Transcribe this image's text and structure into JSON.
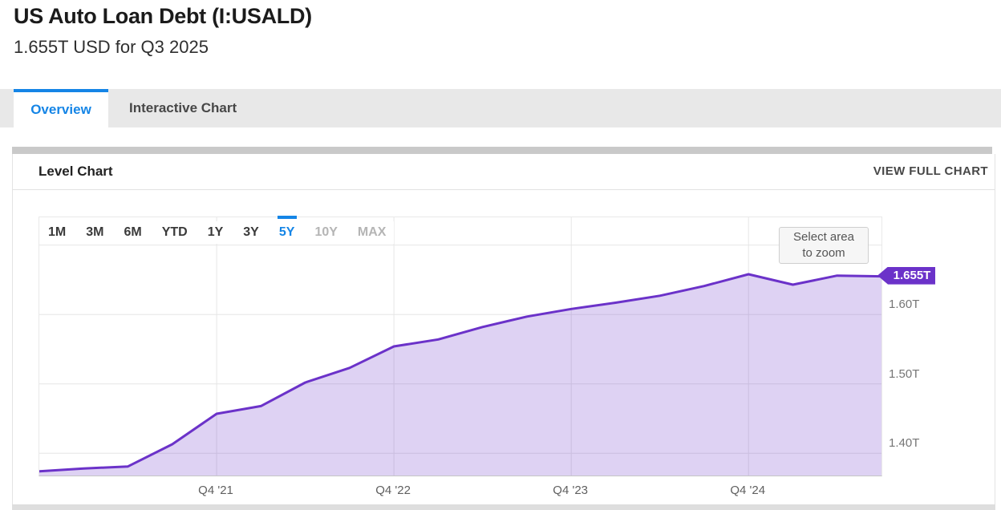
{
  "header": {
    "title": "US Auto Loan Debt (I:USALD)",
    "subtitle": "1.655T USD for Q3 2025"
  },
  "tabs": [
    {
      "label": "Overview",
      "active": true
    },
    {
      "label": "Interactive Chart",
      "active": false
    }
  ],
  "card": {
    "title": "Level Chart",
    "action_label": "VIEW FULL CHART"
  },
  "range_selector": {
    "options": [
      "1M",
      "3M",
      "6M",
      "YTD",
      "1Y",
      "3Y",
      "5Y",
      "10Y",
      "MAX"
    ],
    "selected": "5Y",
    "disabled": [
      "10Y",
      "MAX"
    ]
  },
  "zoom_hint": {
    "line1": "Select area",
    "line2": "to zoom"
  },
  "last_value_badge": "1.655T",
  "colors": {
    "accent_blue": "#1585e6",
    "line_purple": "#6b32c9",
    "badge_purple": "#6b32c9",
    "gridline_gray": "#e6e6e6",
    "area_fill_opacity": 0.22
  },
  "chart_data": {
    "type": "area",
    "title": "Level Chart",
    "unit": "USD trillions",
    "x": [
      "Q4 '20",
      "Q1 '21",
      "Q2 '21",
      "Q3 '21",
      "Q4 '21",
      "Q1 '22",
      "Q2 '22",
      "Q3 '22",
      "Q4 '22",
      "Q1 '23",
      "Q2 '23",
      "Q3 '23",
      "Q4 '23",
      "Q1 '24",
      "Q2 '24",
      "Q3 '24",
      "Q4 '24",
      "Q1 '25",
      "Q2 '25",
      "Q3 '25"
    ],
    "values": [
      1.374,
      1.378,
      1.381,
      1.413,
      1.457,
      1.468,
      1.502,
      1.523,
      1.554,
      1.564,
      1.582,
      1.597,
      1.608,
      1.617,
      1.627,
      1.641,
      1.658,
      1.643,
      1.656,
      1.655
    ],
    "last_value_label": "1.655T",
    "x_tick_indices": [
      4,
      8,
      12,
      16
    ],
    "x_tick_labels": [
      "Q4 '21",
      "Q4 '22",
      "Q4 '23",
      "Q4 '24"
    ],
    "y_ticks": [
      {
        "value": 1.4,
        "label": "1.40T"
      },
      {
        "value": 1.5,
        "label": "1.50T"
      },
      {
        "value": 1.6,
        "label": "1.60T"
      }
    ],
    "y_gridlines": [
      1.4,
      1.5,
      1.6,
      1.7
    ],
    "ylim": [
      1.368,
      1.74
    ],
    "grid": true,
    "legend": "none"
  }
}
